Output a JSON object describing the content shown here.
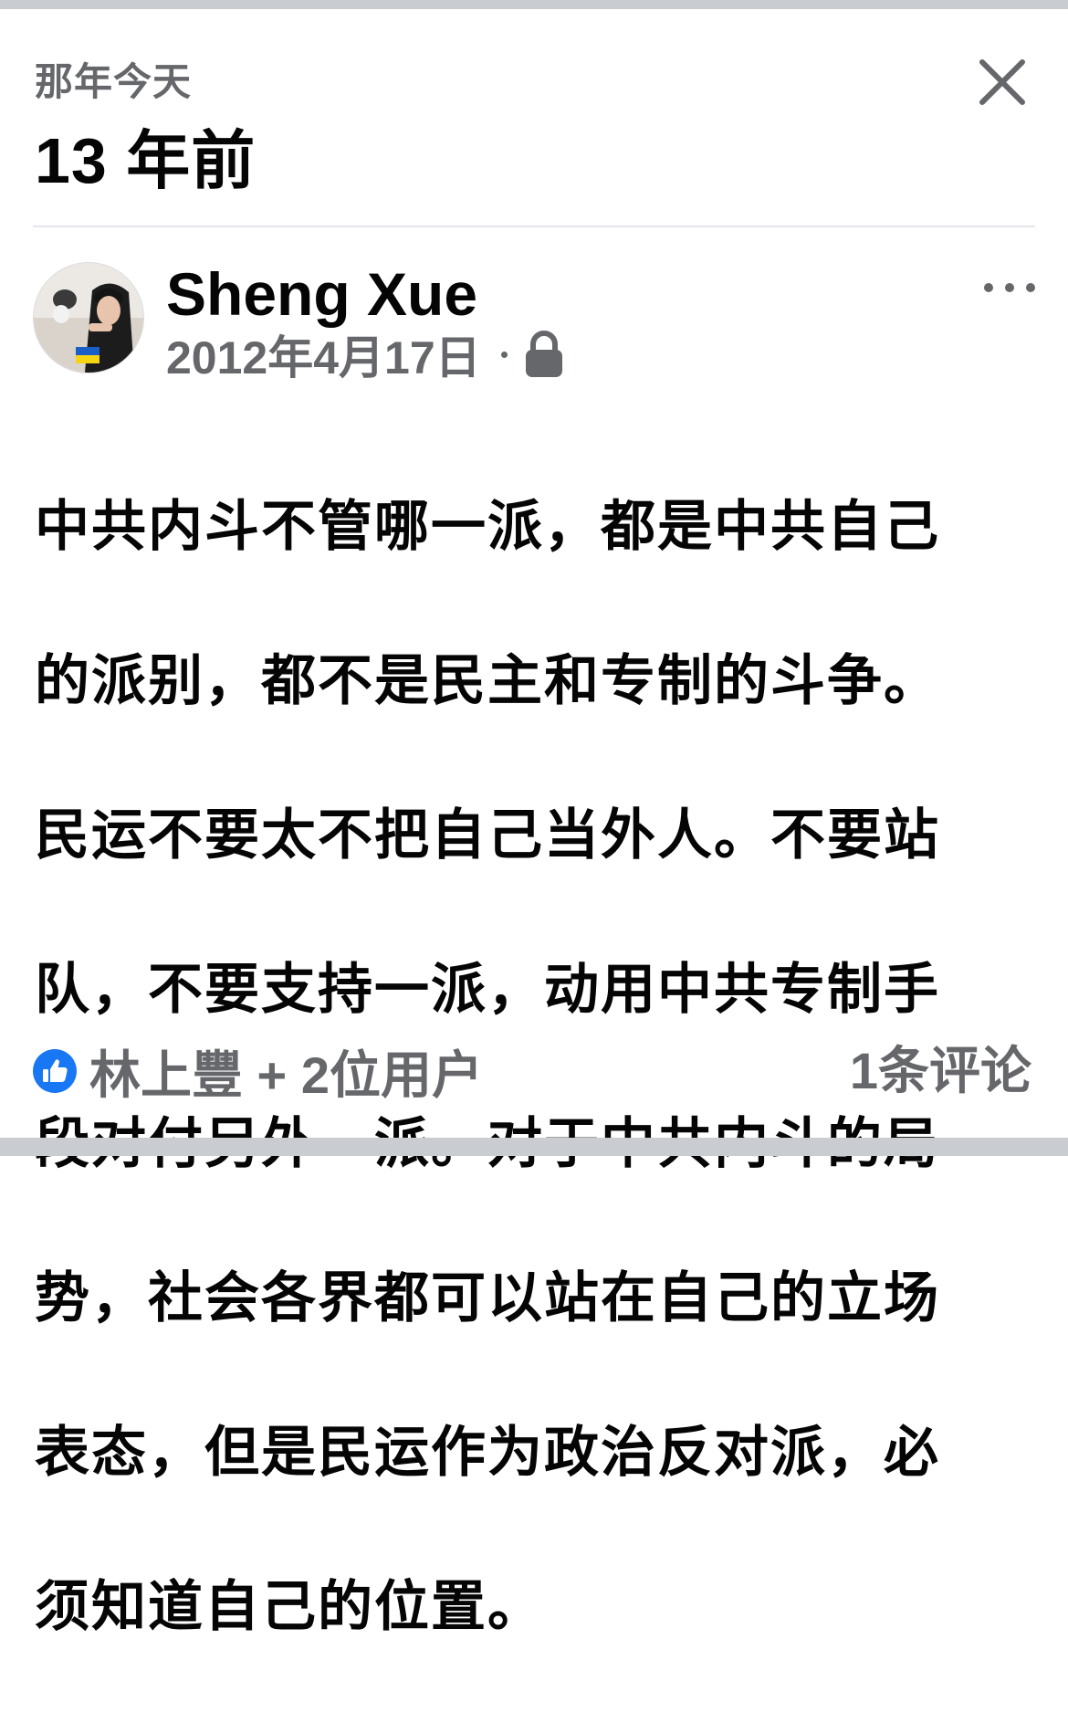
{
  "header": {
    "kicker": "那年今天",
    "headline": "13 年前",
    "close_icon": "close-icon"
  },
  "post": {
    "author": "Sheng Xue",
    "date": "2012年4月17日",
    "separator": "·",
    "privacy_icon": "lock-icon",
    "more_icon": "more-icon",
    "lines": [
      "中共内斗不管哪一派，都是中共自己",
      "的派别，都不是民主和专制的斗争。",
      "民运不要太不把自己当外人。不要站",
      "队，不要支持一派，动用中共专制手",
      "段对付另外一派。对于中共内斗的局",
      "势，社会各界都可以站在自己的立场",
      "表态，但是民运作为政治反对派，必",
      "须知道自己的位置。"
    ]
  },
  "footer": {
    "like_icon": "like-icon",
    "reactions": "林上豐 + 2位用户",
    "comments": "1条评论"
  },
  "colors": {
    "text_primary": "#050505",
    "text_secondary": "#65676b",
    "accent_blue": "#1877f2",
    "separator_bar": "#c9ccd1",
    "divider": "#e4e6eb"
  }
}
